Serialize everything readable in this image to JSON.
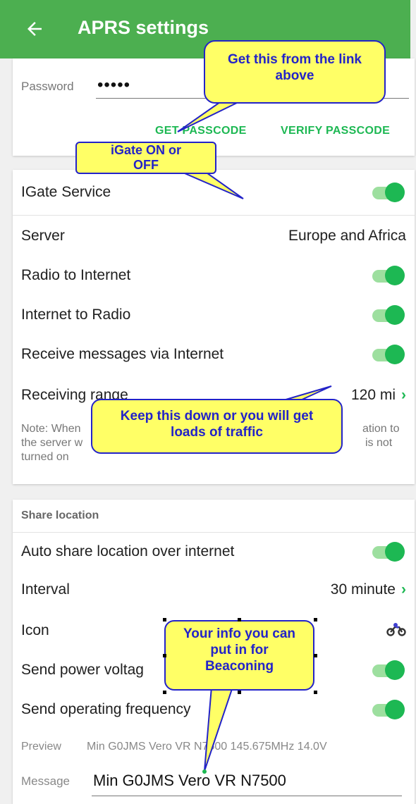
{
  "app": {
    "title": "APRS settings"
  },
  "account": {
    "password_label": "Password",
    "password_value": "•••••",
    "get_passcode": "GET PASSCODE",
    "verify_passcode": "VERIFY PASSCODE"
  },
  "igate": {
    "service_label": "IGate Service",
    "service_on": true,
    "server_label": "Server",
    "server_value": "Europe and Africa",
    "radio_to_internet": "Radio to Internet",
    "internet_to_radio": "Internet to Radio",
    "receive_messages": "Receive messages via Internet",
    "receiving_range_label": "Receiving range",
    "receiving_range_value": "120 mi",
    "note_line1": "Note: When",
    "note_line1_end": "ation to",
    "note_line2": "the server w",
    "note_line2_end": "is not",
    "note_line3": "turned on"
  },
  "share": {
    "header": "Share location",
    "auto_share": "Auto share location over internet",
    "interval_label": "Interval",
    "interval_value": "30 minute",
    "icon_label": "Icon",
    "icon_name": "motorcycle-icon",
    "send_power": "Send power voltag",
    "send_frequency": "Send operating frequency",
    "preview_label": "Preview",
    "preview_value": "Min G0JMS Vero VR N7500 145.675MHz 14.0V",
    "message_label": "Message",
    "message_value": "Min G0JMS Vero VR N7500"
  },
  "callouts": {
    "passcode": [
      "Get this from the link",
      "above"
    ],
    "igate": [
      "iGate ON or",
      "OFF"
    ],
    "range": [
      "Keep this down or you will get",
      "loads of traffic"
    ],
    "beacon": [
      "Your info you can",
      "put in for",
      "Beaconing"
    ]
  },
  "colors": {
    "appbar": "#4caf50",
    "accent": "#1db853",
    "callout_fill": "#ffff66",
    "callout_text": "#2323c8"
  }
}
